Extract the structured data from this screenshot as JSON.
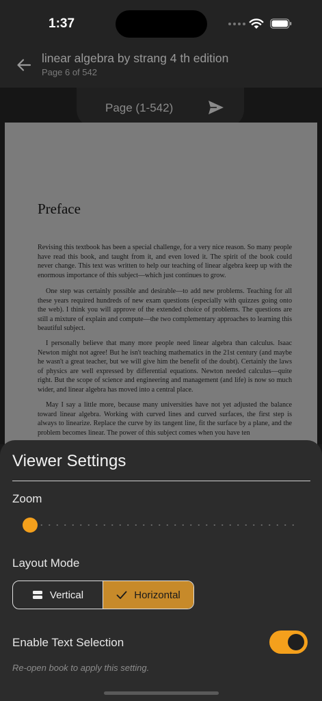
{
  "status_bar": {
    "time": "1:37"
  },
  "header": {
    "title": "linear algebra by strang 4 th edition",
    "subtitle": "Page 6 of 542"
  },
  "page_jump": {
    "placeholder": "Page (1-542)"
  },
  "document": {
    "heading": "Preface",
    "paragraphs": [
      "Revising this textbook has been a special challenge, for a very nice reason. So many people have read this book, and taught from it, and even loved it. The spirit of the book could never change. This text was written to help our teaching of linear algebra keep up with the enormous importance of this subject—which just continues to grow.",
      "One step was certainly possible and desirable—to add new problems. Teaching for all these years required hundreds of new exam questions (especially with quizzes going onto the web). I think you will approve of the extended choice of problems. The questions are still a mixture of explain and compute—the two complementary approaches to learning this beautiful subject.",
      "I personally believe that many more people need linear algebra than calculus. Isaac Newton might not agree! But he isn't teaching mathematics in the 21st century (and maybe he wasn't a great teacher, but we will give him the benefit of the doubt). Certainly the laws of physics are well expressed by differential equations. Newton needed calculus—quite right. But the scope of science and engineering and management (and life) is now so much wider, and linear algebra has moved into a central place.",
      "May I say a little more, because many universities have not yet adjusted the balance toward linear algebra. Working with curved lines and curved surfaces, the first step is always to linearize. Replace the curve by its tangent line, fit the surface by a plane, and the problem becomes linear. The power of this subject comes when you have ten"
    ]
  },
  "settings": {
    "title": "Viewer Settings",
    "zoom_label": "Zoom",
    "zoom_value": 0,
    "layout_label": "Layout Mode",
    "layout_options": [
      {
        "label": "Vertical",
        "icon": "vertical-layout-icon",
        "selected": false
      },
      {
        "label": "Horizontal",
        "icon": "check-icon",
        "selected": true
      }
    ],
    "text_selection_label": "Enable Text Selection",
    "text_selection_enabled": true,
    "hint": "Re-open book to apply this setting."
  },
  "colors": {
    "accent": "#f4a01c",
    "segment_selected": "#c78a2a",
    "sheet_bg": "#2c2c2c"
  }
}
